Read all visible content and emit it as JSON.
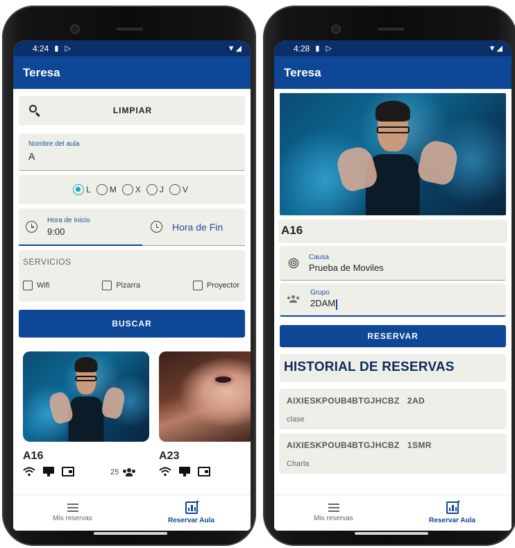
{
  "left": {
    "status": {
      "time": "4:24"
    },
    "appbar": {
      "title": "Teresa"
    },
    "search": {
      "clear_label": "LIMPIAR"
    },
    "room_field": {
      "label": "Nombre del aula",
      "value": "A"
    },
    "days": [
      {
        "letter": "L",
        "selected": true
      },
      {
        "letter": "M",
        "selected": false
      },
      {
        "letter": "X",
        "selected": false
      },
      {
        "letter": "J",
        "selected": false
      },
      {
        "letter": "V",
        "selected": false
      }
    ],
    "time_start": {
      "label": "Hora de Inicio",
      "value": "9:00"
    },
    "time_end": {
      "placeholder": "Hora de Fin"
    },
    "services": {
      "title": "SERVICIOS",
      "options": [
        "Wifi",
        "Pizarra",
        "Proyector"
      ]
    },
    "search_button": "BUSCAR",
    "results": [
      {
        "name": "A16",
        "capacity": "25"
      },
      {
        "name": "A23"
      }
    ]
  },
  "right": {
    "status": {
      "time": "4:28"
    },
    "appbar": {
      "title": "Teresa"
    },
    "room_name": "A16",
    "cause_field": {
      "label": "Causa",
      "value": "Prueba de Moviles"
    },
    "group_field": {
      "label": "Grupo",
      "value": "2DAM"
    },
    "reserve_button": "RESERVAR",
    "history": {
      "title": "HISTORIAL DE RESERVAS",
      "items": [
        {
          "code": "AIXIESKPOUB4BTGJHCBZ",
          "group": "2AD",
          "description": "clase"
        },
        {
          "code": "AIXIESKPOUB4BTGJHCBZ",
          "group": "1SMR",
          "description": "Charla"
        }
      ]
    }
  },
  "nav": {
    "my_reservations": "Mis reservas",
    "reserve_room": "Reservar Aula"
  },
  "colors": {
    "primary": "#0d4796",
    "status_bar": "#0b2f69",
    "radio_selected": "#18a8c2",
    "card_bg": "#efefe9"
  }
}
